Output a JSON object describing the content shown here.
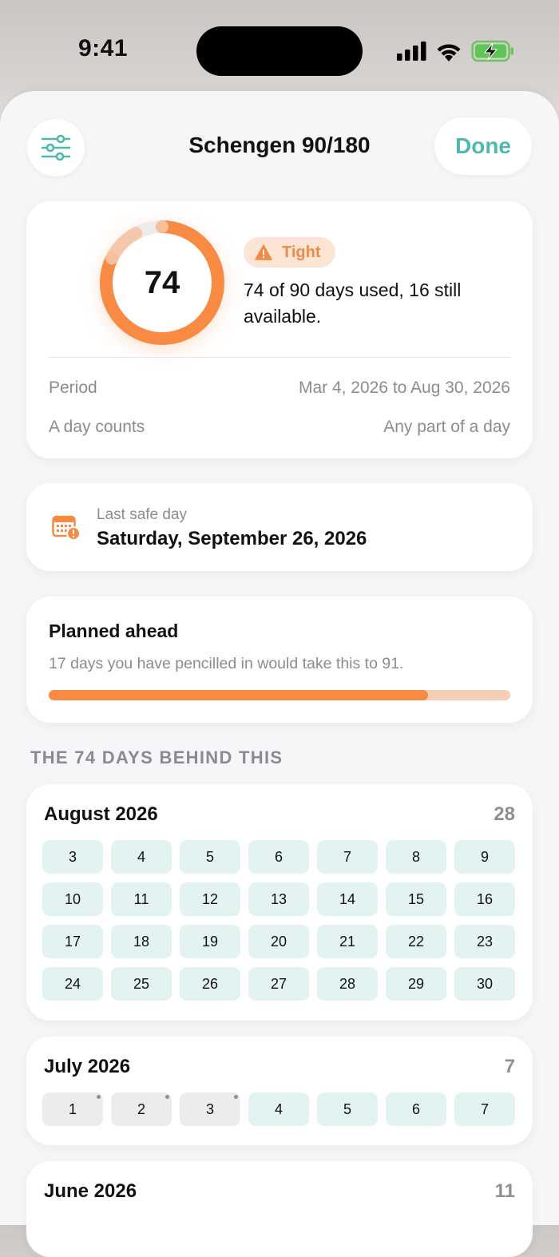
{
  "status_bar": {
    "time": "9:41"
  },
  "nav": {
    "title": "Schengen 90/180",
    "done_label": "Done",
    "settings_icon": "sliders-icon"
  },
  "summary": {
    "days_used": "74",
    "progress_fraction": 0.822,
    "badge_label": "Tight",
    "description": "74 of 90 days used, 16 still available.",
    "period_label": "Period",
    "period_value": "Mar 4, 2026 to Aug 30, 2026",
    "count_label": "A day counts",
    "count_value": "Any part of a day"
  },
  "last_safe": {
    "label": "Last safe day",
    "value": "Saturday, September 26, 2026"
  },
  "planned": {
    "title": "Planned ahead",
    "subtitle": "17 days you have pencilled in would take this to 91.",
    "progress_fraction": 0.822
  },
  "section_header": "THE 74 DAYS BEHIND THIS",
  "months": [
    {
      "title": "August 2026",
      "count": "28",
      "days": [
        {
          "n": "3"
        },
        {
          "n": "4"
        },
        {
          "n": "5"
        },
        {
          "n": "6"
        },
        {
          "n": "7"
        },
        {
          "n": "8"
        },
        {
          "n": "9"
        },
        {
          "n": "10"
        },
        {
          "n": "11"
        },
        {
          "n": "12"
        },
        {
          "n": "13"
        },
        {
          "n": "14"
        },
        {
          "n": "15"
        },
        {
          "n": "16"
        },
        {
          "n": "17"
        },
        {
          "n": "18"
        },
        {
          "n": "19"
        },
        {
          "n": "20"
        },
        {
          "n": "21"
        },
        {
          "n": "22"
        },
        {
          "n": "23"
        },
        {
          "n": "24"
        },
        {
          "n": "25"
        },
        {
          "n": "26"
        },
        {
          "n": "27"
        },
        {
          "n": "28"
        },
        {
          "n": "29"
        },
        {
          "n": "30"
        }
      ]
    },
    {
      "title": "July 2026",
      "count": "7",
      "days": [
        {
          "n": "1",
          "grey": true,
          "dot": true
        },
        {
          "n": "2",
          "grey": true,
          "dot": true
        },
        {
          "n": "3",
          "grey": true,
          "dot": true
        },
        {
          "n": "4"
        },
        {
          "n": "5"
        },
        {
          "n": "6"
        },
        {
          "n": "7"
        }
      ]
    },
    {
      "title": "June 2026",
      "count": "11",
      "days": []
    }
  ],
  "colors": {
    "accent": "#4fb9ad",
    "warning": "#f98a44",
    "badge_bg": "#fde5d6",
    "day_bg": "#e3f3f2"
  }
}
